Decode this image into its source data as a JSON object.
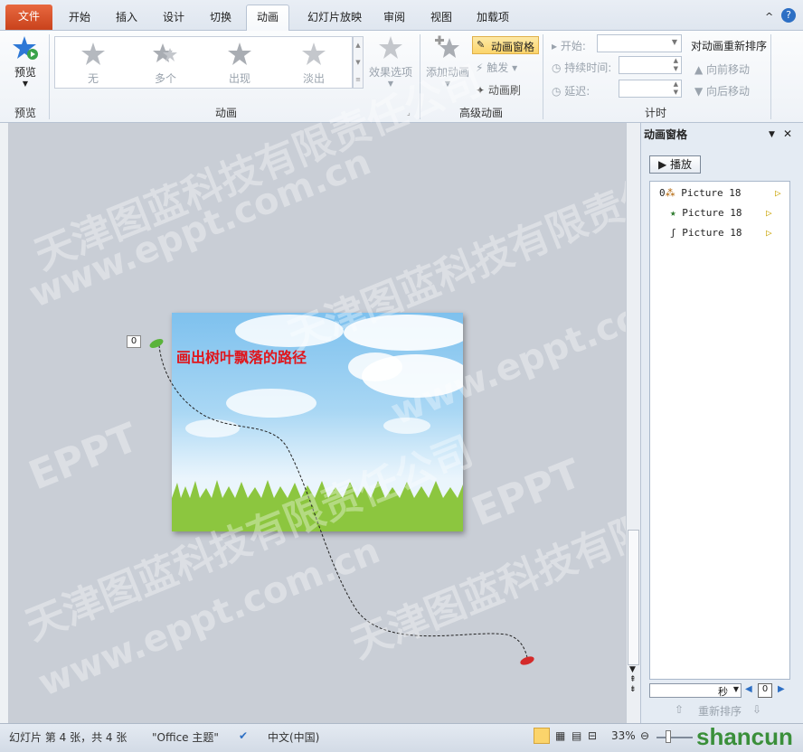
{
  "tabs": {
    "file": "文件",
    "home": "开始",
    "insert": "插入",
    "design": "设计",
    "transitions": "切换",
    "animations": "动画",
    "slideshow": "幻灯片放映",
    "review": "审阅",
    "view": "视图",
    "addins": "加载项"
  },
  "ribbon": {
    "preview": {
      "label": "预览",
      "group": "预览"
    },
    "animation_gallery": [
      {
        "label": "无"
      },
      {
        "label": "多个"
      },
      {
        "label": "出现"
      },
      {
        "label": "淡出"
      }
    ],
    "effect_options": "效果选项",
    "animation_group": "动画",
    "add_animation": "添加动画",
    "animation_pane": "动画窗格",
    "trigger": "触发",
    "animation_painter": "动画刷",
    "advanced_group": "高级动画",
    "start_label": "开始:",
    "duration_label": "持续时间:",
    "delay_label": "延迟:",
    "timing_group": "计时",
    "reorder_title": "对动画重新排序",
    "move_earlier": "向前移动",
    "move_later": "向后移动"
  },
  "slide": {
    "title_text": "画出树叶飘落的路径",
    "tag": "0"
  },
  "pane": {
    "title": "动画窗格",
    "play": "播放",
    "items": [
      {
        "num": "0",
        "name": "Picture 18"
      },
      {
        "num": "",
        "name": "Picture 18"
      },
      {
        "num": "",
        "name": "Picture 18"
      }
    ],
    "seconds": "秒",
    "timeline_value": "0",
    "reorder": "重新排序"
  },
  "status": {
    "slide_info": "幻灯片 第 4 张，共 4 张",
    "theme": "\"Office 主题\"",
    "language": "中文(中国)",
    "zoom": "33%"
  },
  "watermarks": [
    "天津图蓝科技有限责任公司",
    "www.eppt.com.cn",
    "EPPT",
    "shancun"
  ],
  "colors": {
    "accent": "#c9421c",
    "title_red": "#e0161c"
  }
}
